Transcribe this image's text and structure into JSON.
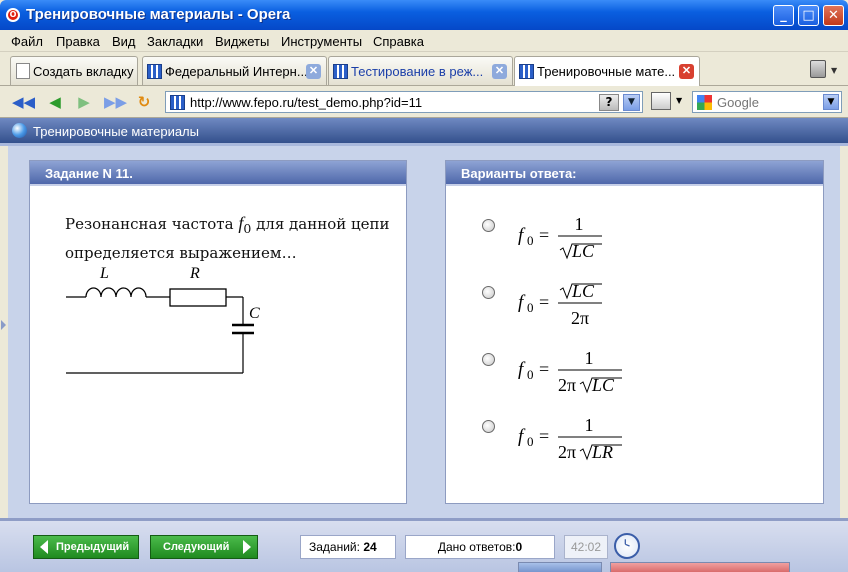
{
  "window": {
    "title": "Тренировочные материалы - Opera"
  },
  "menu": [
    "Файл",
    "Правка",
    "Вид",
    "Закладки",
    "Виджеты",
    "Инструменты",
    "Справка"
  ],
  "tabs": {
    "new_tab": "Создать вкладку",
    "items": [
      {
        "label": "Федеральный Интерн..."
      },
      {
        "label": "Тестирование в реж..."
      },
      {
        "label": "Тренировочные мате..."
      }
    ]
  },
  "address": {
    "url": "http://www.fepo.ru/test_demo.php?id=11",
    "help": "?"
  },
  "search": {
    "placeholder": "Google"
  },
  "page": {
    "title": "Тренировочные материалы"
  },
  "task": {
    "header": "Задание N 11.",
    "text_before": "Резонансная частота",
    "var": "f",
    "var_sub": "0",
    "text_after": "для данной цепи определяется выражением…",
    "labels": {
      "L": "L",
      "R": "R",
      "C": "C"
    }
  },
  "answers": {
    "header": "Варианты ответа:",
    "lhs": "f",
    "lhs_sub": "0",
    "eq": "=",
    "options": [
      {
        "num": "1",
        "den_coef": "",
        "den_rad": "LC",
        "num_rad": ""
      },
      {
        "num": "",
        "den_coef": "2π",
        "den_rad": "",
        "num_rad": "LC"
      },
      {
        "num": "1",
        "den_coef": "2π",
        "den_rad": "LC",
        "num_rad": ""
      },
      {
        "num": "1",
        "den_coef": "2π",
        "den_rad": "LR",
        "num_rad": ""
      }
    ]
  },
  "footer": {
    "prev": "Предыдущий",
    "next": "Следующий",
    "tasks_label": "Заданий:",
    "tasks_count": "24",
    "answers_label": "Дано ответов:",
    "answers_count": "0",
    "timer": "42:02"
  },
  "colors": {
    "accent": "#33508c",
    "green": "#1f8a1f"
  }
}
